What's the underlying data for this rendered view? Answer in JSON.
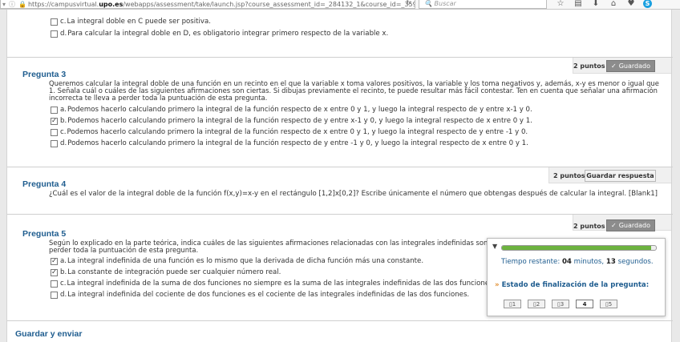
{
  "browser": {
    "url_prefix": "https://campusvirtual.",
    "url_domain": "upo.es",
    "url_rest": "/webapps/assessment/take/launch.jsp?course_assessment_id=_284132_1&course_id=_3591",
    "search_placeholder": "Buscar"
  },
  "prev_question": {
    "options": [
      {
        "letter": "c.",
        "text": "La integral doble en C puede ser positiva.",
        "checked": false
      },
      {
        "letter": "d.",
        "text": "Para calcular la integral doble en D, es obligatorio integrar primero respecto de la variable x.",
        "checked": false
      }
    ]
  },
  "q3": {
    "title": "Pregunta 3",
    "points": "2 puntos",
    "status": "Guardado",
    "text": "Queremos calcular la integral doble de una función en un recinto en el que la variable x toma valores positivos, la variable y los toma negativos y, además, x-y es menor o igual que 1. Señala cuál o cuáles de las siguientes afirmaciones son ciertas. Si dibujas previamente el recinto, te puede resultar más fácil contestar. Ten en cuenta que señalar una afirmación incorrecta te lleva a perder toda la puntuación de esta pregunta.",
    "options": [
      {
        "letter": "a.",
        "text": "Podemos hacerlo calculando primero la integral de la función respecto de x entre 0 y 1, y luego la integral respecto de y entre x-1 y 0.",
        "checked": false
      },
      {
        "letter": "b.",
        "text": "Podemos hacerlo calculando primero la integral de la función respecto de y entre x-1 y 0, y luego la integral respecto de x entre 0 y 1.",
        "checked": true
      },
      {
        "letter": "c.",
        "text": "Podemos hacerlo calculando primero la integral de la función respecto de x entre 0 y 1, y luego la integral respecto de y entre -1 y 0.",
        "checked": false
      },
      {
        "letter": "d.",
        "text": "Podemos hacerlo calculando primero la integral de la función respecto de y entre -1 y 0, y luego la integral respecto de x entre 0 y 1.",
        "checked": false
      }
    ]
  },
  "q4": {
    "title": "Pregunta 4",
    "points": "2 puntos",
    "save_label": "Guardar respuesta",
    "text": "¿Cuál es el valor de la integral doble de la función f(x,y)=x-y en el rectángulo [1,2]x[0,2]? Escribe únicamente el número que obtengas después de calcular la integral. [Blank1]"
  },
  "q5": {
    "title": "Pregunta 5",
    "points": "2 puntos",
    "status": "Guardado",
    "text_line1": "Según lo explicado en la parte teórica, indica cuáles de las siguientes afirmaciones relacionadas con las integrales indefinidas son correctas. Ten en",
    "text_line2": "perder toda la puntuación de esta pregunta.",
    "options": [
      {
        "letter": "a.",
        "text": "La integral indefinida de una función es lo mismo que la derivada de dicha función más una constante.",
        "checked": true
      },
      {
        "letter": "b.",
        "text": "La constante de integración puede ser cualquier número real.",
        "checked": true
      },
      {
        "letter": "c.",
        "text": "La integral indefinida de la suma de dos funciones no siempre es la suma de las integrales indefinidas de las dos funciones.",
        "checked": false
      },
      {
        "letter": "d.",
        "text": "La integral indefinida del cociente de dos funciones es el cociente de las integrales indefinidas de las dos funciones.",
        "checked": false
      }
    ]
  },
  "timer": {
    "label": "Tiempo restante:",
    "minutes": "04",
    "minutes_word": "minutos,",
    "seconds": "13",
    "seconds_word": "segundos.",
    "progress_fraction": 0.97,
    "status_label": "Estado de finalización de la pregunta:",
    "nav": [
      "1",
      "2",
      "3",
      "4",
      "5"
    ],
    "current": "4"
  },
  "footer": {
    "title": "Guardar y enviar"
  },
  "colors": {
    "title_blue": "#1f5d8f",
    "progress_green": "#6db33f",
    "saved_grey": "#8c8c8c"
  }
}
